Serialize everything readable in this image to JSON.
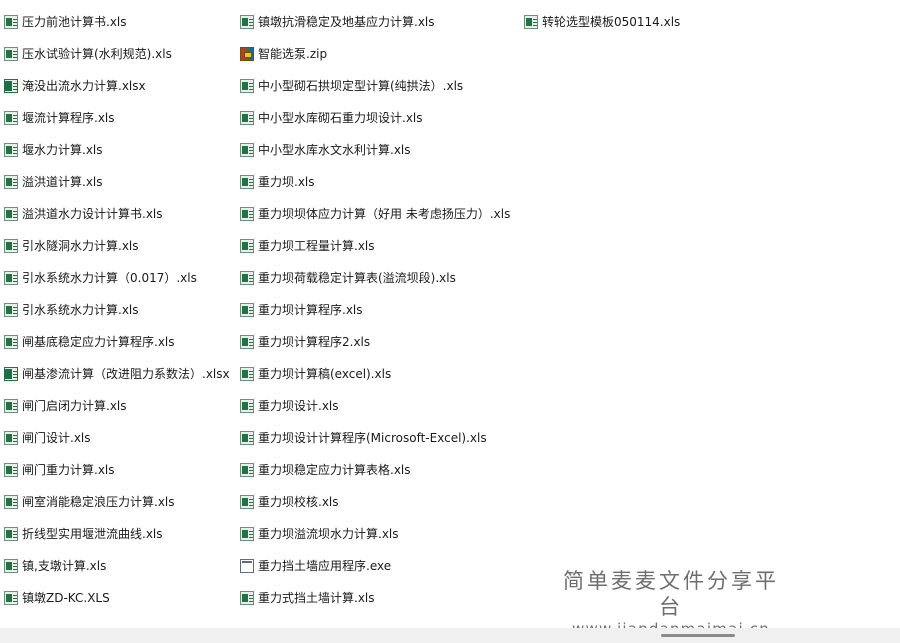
{
  "columns": [
    [
      {
        "name": "压力前池计算书.xls",
        "icon": "excel-icon",
        "type": "xls"
      },
      {
        "name": "压水试验计算(水利规范).xls",
        "icon": "excel-icon",
        "type": "xls"
      },
      {
        "name": "淹没出流水力计算.xlsx",
        "icon": "excel-xlsx-icon",
        "type": "xlsx"
      },
      {
        "name": "堰流计算程序.xls",
        "icon": "excel-icon",
        "type": "xls"
      },
      {
        "name": "堰水力计算.xls",
        "icon": "excel-icon",
        "type": "xls"
      },
      {
        "name": "溢洪道计算.xls",
        "icon": "excel-icon",
        "type": "xls"
      },
      {
        "name": "溢洪道水力设计计算书.xls",
        "icon": "excel-icon",
        "type": "xls"
      },
      {
        "name": "引水隧洞水力计算.xls",
        "icon": "excel-icon",
        "type": "xls"
      },
      {
        "name": "引水系统水力计算（0.017）.xls",
        "icon": "excel-icon",
        "type": "xls"
      },
      {
        "name": "引水系统水力计算.xls",
        "icon": "excel-icon",
        "type": "xls"
      },
      {
        "name": "闸基底稳定应力计算程序.xls",
        "icon": "excel-icon",
        "type": "xls"
      },
      {
        "name": "闸基渗流计算（改进阻力系数法）.xlsx",
        "icon": "excel-xlsx-icon",
        "type": "xlsx"
      },
      {
        "name": "闸门启闭力计算.xls",
        "icon": "excel-icon",
        "type": "xls"
      },
      {
        "name": "闸门设计.xls",
        "icon": "excel-icon",
        "type": "xls"
      },
      {
        "name": "闸门重力计算.xls",
        "icon": "excel-icon",
        "type": "xls"
      },
      {
        "name": "闸室消能稳定浪压力计算.xls",
        "icon": "excel-icon",
        "type": "xls"
      },
      {
        "name": "折线型实用堰泄流曲线.xls",
        "icon": "excel-icon",
        "type": "xls"
      },
      {
        "name": "镇,支墩计算.xls",
        "icon": "excel-icon",
        "type": "xls"
      },
      {
        "name": "镇墩ZD-KC.XLS",
        "icon": "excel-icon",
        "type": "xls"
      }
    ],
    [
      {
        "name": "镇墩抗滑稳定及地基应力计算.xls",
        "icon": "excel-icon",
        "type": "xls"
      },
      {
        "name": "智能选泵.zip",
        "icon": "winrar-archive-icon",
        "type": "zip"
      },
      {
        "name": "中小型砌石拱坝定型计算(纯拱法）.xls",
        "icon": "excel-icon",
        "type": "xls"
      },
      {
        "name": "中小型水库砌石重力坝设计.xls",
        "icon": "excel-icon",
        "type": "xls"
      },
      {
        "name": "中小型水库水文水利计算.xls",
        "icon": "excel-icon",
        "type": "xls"
      },
      {
        "name": "重力坝.xls",
        "icon": "excel-icon",
        "type": "xls"
      },
      {
        "name": "重力坝坝体应力计算（好用  未考虑扬压力）.xls",
        "icon": "excel-icon",
        "type": "xls"
      },
      {
        "name": "重力坝工程量计算.xls",
        "icon": "excel-icon",
        "type": "xls"
      },
      {
        "name": "重力坝荷载稳定计算表(溢流坝段).xls",
        "icon": "excel-icon",
        "type": "xls"
      },
      {
        "name": "重力坝计算程序.xls",
        "icon": "excel-icon",
        "type": "xls"
      },
      {
        "name": "重力坝计算程序2.xls",
        "icon": "excel-icon",
        "type": "xls"
      },
      {
        "name": "重力坝计算稿(excel).xls",
        "icon": "excel-icon",
        "type": "xls"
      },
      {
        "name": "重力坝设计.xls",
        "icon": "excel-icon",
        "type": "xls"
      },
      {
        "name": "重力坝设计计算程序(Microsoft-Excel).xls",
        "icon": "excel-icon",
        "type": "xls"
      },
      {
        "name": "重力坝稳定应力计算表格.xls",
        "icon": "excel-icon",
        "type": "xls"
      },
      {
        "name": "重力坝校核.xls",
        "icon": "excel-icon",
        "type": "xls"
      },
      {
        "name": "重力坝溢流坝水力计算.xls",
        "icon": "excel-icon",
        "type": "xls"
      },
      {
        "name": "重力挡土墙应用程序.exe",
        "icon": "application-icon",
        "type": "exe"
      },
      {
        "name": "重力式挡土墙计算.xls",
        "icon": "excel-icon",
        "type": "xls"
      }
    ],
    [
      {
        "name": "转轮选型模板050114.xls",
        "icon": "excel-icon",
        "type": "xls"
      }
    ]
  ],
  "watermark": {
    "title": "简单麦麦文件分享平台",
    "url": "www.jiandanmaimai.cn"
  },
  "colors": {
    "excel_green": "#217346",
    "text": "#1a1a1a",
    "watermark": "#6e6e6e",
    "scrollbar_track": "#f0f0f0",
    "scrollbar_thumb": "#8a8a8a"
  }
}
